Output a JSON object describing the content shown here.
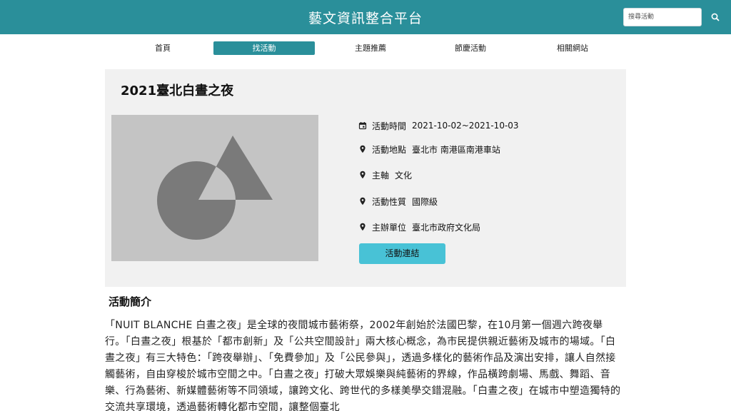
{
  "header": {
    "title": "藝文資訊整合平台",
    "search": {
      "placeholder": "搜尋活動",
      "value": ""
    }
  },
  "nav": {
    "items": [
      {
        "label": "首頁"
      },
      {
        "label": "找活動",
        "active": true
      },
      {
        "label": "主題推薦"
      },
      {
        "label": "節慶活動"
      },
      {
        "label": "相關網站"
      }
    ]
  },
  "event": {
    "title": "2021臺北白晝之夜",
    "info": {
      "time": {
        "label": "活動時間",
        "value": "2021-10-02~2021-10-03",
        "icon": "calendar-icon"
      },
      "location": {
        "label": "活動地點",
        "value": "臺北市 南港區南港車站",
        "icon": "location-pin-icon"
      },
      "theme": {
        "label": "主軸",
        "value": "文化",
        "icon": "location-pin-icon"
      },
      "nature": {
        "label": "活動性質",
        "value": "國際級",
        "icon": "location-pin-icon"
      },
      "organizer": {
        "label": "主辦單位",
        "value": "臺北市政府文化局",
        "icon": "location-pin-icon"
      }
    },
    "link_button": "活動連結"
  },
  "intro": {
    "heading": "活動簡介",
    "text": "「NUIT BLANCHE 白晝之夜」是全球的夜間城市藝術祭，2002年創始於法國巴黎，在10月第一個週六跨夜舉行。「白晝之夜」根基於「都市創新」及「公共空間設計」兩大核心概念，為市民提供親近藝術及城市的場域。「白晝之夜」有三大特色：「跨夜舉辦」、「免費參加」及「公民參與」，透過多樣化的藝術作品及演出安排，讓人自然接觸藝術，自由穿梭於城市空間之中。「白晝之夜」打破大眾娛樂與純藝術的界線，作品橫跨劇場、馬戲、舞蹈、音樂、行為藝術、新媒體藝術等不同領域，讓跨文化、跨世代的多樣美學交錯混融。「白晝之夜」在城市中塑造獨特的交流共享環境，透過藝術轉化都市空間，讓整個臺北"
  },
  "colors": {
    "header_bg": "#2a8f9a",
    "active_tab": "#2a8f9a",
    "link_button": "#48c2d6",
    "card_bg": "#f1f1f1"
  }
}
